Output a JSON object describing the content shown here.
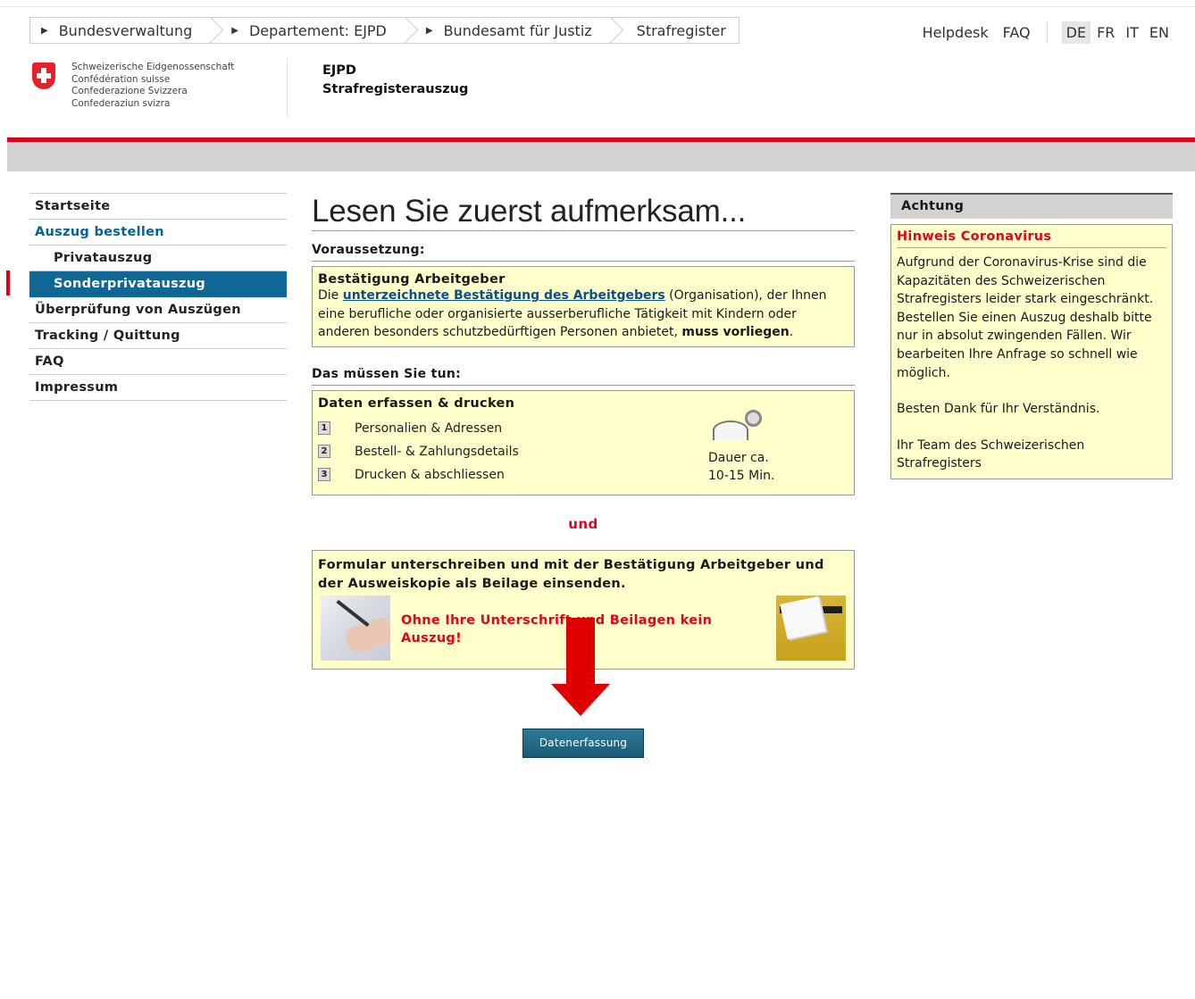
{
  "breadcrumb": [
    "Bundesverwaltung",
    "Departement: EJPD",
    "Bundesamt für Justiz",
    "Strafregister"
  ],
  "topnav": {
    "helpdesk": "Helpdesk",
    "faq": "FAQ",
    "languages": [
      "DE",
      "FR",
      "IT",
      "EN"
    ],
    "active_language": "DE"
  },
  "header": {
    "confederation": [
      "Schweizerische Eidgenossenschaft",
      "Confédération suisse",
      "Confederazione Svizzera",
      "Confederaziun svizra"
    ],
    "dept": "EJPD",
    "title": "Strafregisterauszug"
  },
  "sidebar": {
    "items": [
      "Startseite",
      "Auszug bestellen",
      "Privatauszug",
      "Sonderprivatauszug",
      "Überprüfung von Auszügen",
      "Tracking / Quittung",
      "FAQ",
      "Impressum"
    ]
  },
  "main": {
    "heading": "Lesen Sie zuerst aufmerksam...",
    "prereq_label": "Voraussetzung:",
    "prereq_title": "Bestätigung Arbeitgeber",
    "prereq_text_pre": "Die ",
    "prereq_link": "unterzeichnete Bestätigung des Arbeitgebers",
    "prereq_text_mid": " (Organisation), der Ihnen eine berufliche oder organisierte ausserberufliche Tätigkeit mit Kindern oder anderen besonders schutzbedürftigen Personen anbietet, ",
    "prereq_bold": "muss vorliegen",
    "prereq_end": ".",
    "todo_label": "Das müssen Sie tun:",
    "step_box_title": "Daten erfassen & drucken",
    "steps": [
      {
        "num": "1",
        "label": "Personalien & Adressen"
      },
      {
        "num": "2",
        "label": "Bestell- & Zahlungsdetails"
      },
      {
        "num": "3",
        "label": "Drucken & abschliessen"
      }
    ],
    "duration_label": "Dauer ca.",
    "duration_value": "10-15 Min.",
    "and": "und",
    "sign_title": "Formular unterschreiben und mit der Bestätigung Arbeitgeber und der Ausweiskopie als Beilage einsenden.",
    "sign_warning": "Ohne Ihre Unterschrift und Beilagen kein Auszug!",
    "button": "Datenerfassung"
  },
  "notice": {
    "header": "Achtung",
    "title": "Hinweis Coronavirus",
    "p1": "Aufgrund der Coronavirus-Krise sind die Kapazitäten des Schweizerischen Strafregisters leider stark eingeschränkt. Bestellen Sie einen Auszug deshalb bitte nur in absolut zwingenden Fällen. Wir bearbeiten Ihre Anfrage so schnell wie möglich.",
    "p2": "Besten Dank für Ihr Verständnis.",
    "p3": "Ihr Team des Schweizerischen Strafregisters"
  },
  "colors": {
    "accent_red": "#dc0018",
    "nav_active": "#0f6796",
    "notice_bg": "#ffffcc",
    "button": "#1b5a74"
  },
  "icons": [
    "swiss-cross-icon",
    "stopwatch-icon",
    "down-arrow-icon",
    "triangle-right-icon"
  ]
}
